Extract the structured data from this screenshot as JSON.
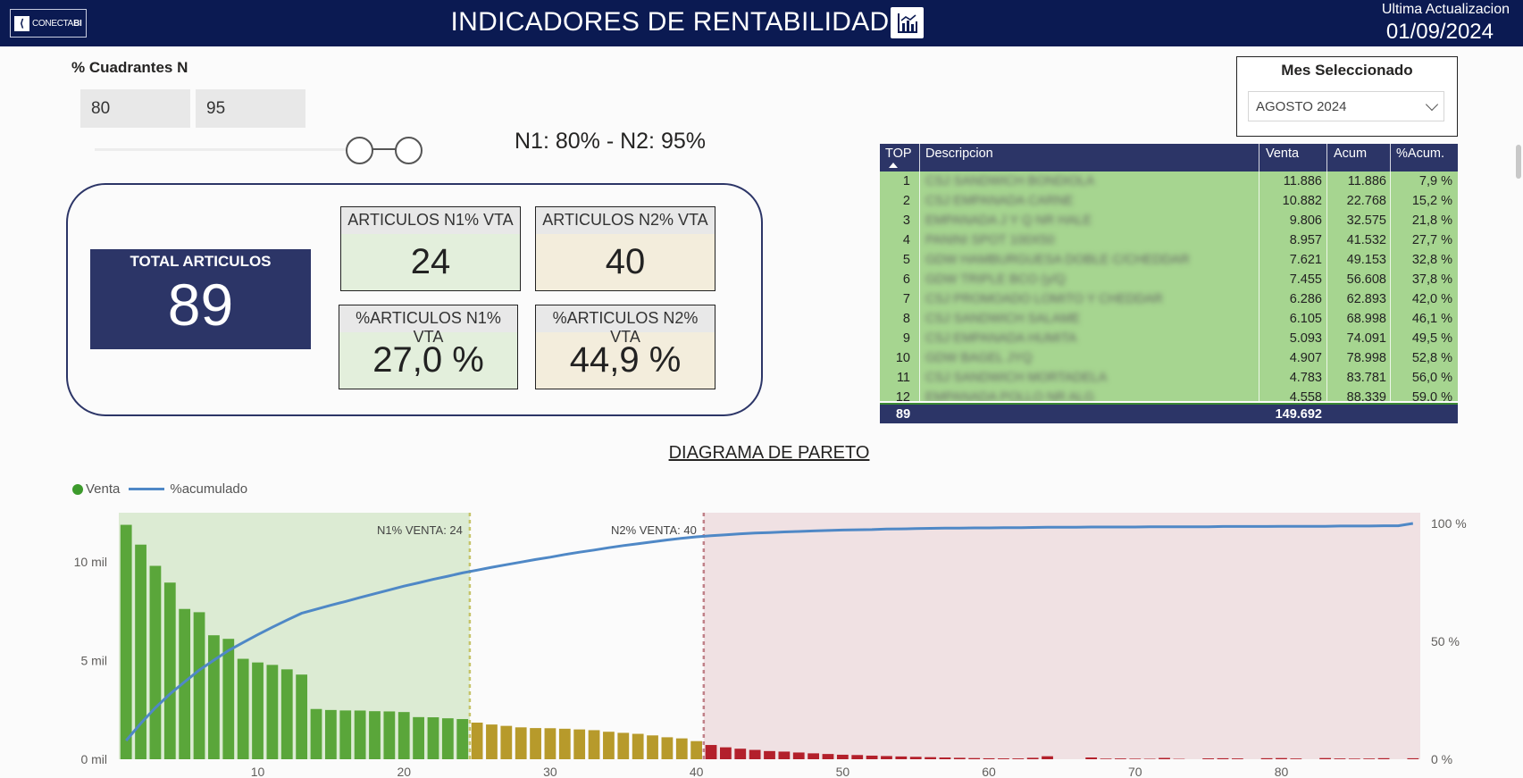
{
  "header": {
    "logo_text": "CONECTA",
    "logo_bold": "BI",
    "title": "INDICADORES DE RENTABILIDAD",
    "update_label": "Ultima Actualizacion",
    "update_date": "01/09/2024",
    "icon": "chart-report-icon"
  },
  "quadrants": {
    "title": "% Cuadrantes N",
    "n1": "80",
    "n2": "95",
    "summary": "N1: 80%   -   N2: 95%"
  },
  "kpis": {
    "total_label": "TOTAL ARTICULOS",
    "total_value": "89",
    "n1_label": "ARTICULOS N1% VTA",
    "n1_value": "24",
    "n2_label": "ARTICULOS N2% VTA",
    "n2_value": "40",
    "pct_n1_label": "%ARTICULOS N1% VTA",
    "pct_n1_value": "27,0 %",
    "pct_n2_label": "%ARTICULOS N2% VTA",
    "pct_n2_value": "44,9 %"
  },
  "month_filter": {
    "title": "Mes Seleccionado",
    "selected": "AGOSTO 2024"
  },
  "table": {
    "headers": [
      "TOP",
      "Descripcion",
      "Venta",
      "Acum",
      "%Acum."
    ],
    "rows": [
      {
        "top": "1",
        "desc": "CSJ SANDWICH BONDIOLA",
        "venta": "11.886",
        "acum": "11.886",
        "pct": "7,9 %"
      },
      {
        "top": "2",
        "desc": "CSJ EMPANADA CARNE",
        "venta": "10.882",
        "acum": "22.768",
        "pct": "15,2 %"
      },
      {
        "top": "3",
        "desc": "EMPANADA J Y Q NR HALE",
        "venta": "9.806",
        "acum": "32.575",
        "pct": "21,8 %"
      },
      {
        "top": "4",
        "desc": "PANINI SPOT 100X50",
        "venta": "8.957",
        "acum": "41.532",
        "pct": "27,7 %"
      },
      {
        "top": "5",
        "desc": "GDW HAMBURGUESA DOBLE C/CHEDDAR",
        "venta": "7.621",
        "acum": "49.153",
        "pct": "32,8 %"
      },
      {
        "top": "6",
        "desc": "GDW TRIPLE BCO (y/Q",
        "venta": "7.455",
        "acum": "56.608",
        "pct": "37,8 %"
      },
      {
        "top": "7",
        "desc": "CSJ PROMOADO LOMITO Y CHEDDAR",
        "venta": "6.286",
        "acum": "62.893",
        "pct": "42,0 %"
      },
      {
        "top": "8",
        "desc": "CSJ SANDWICH SALAME",
        "venta": "6.105",
        "acum": "68.998",
        "pct": "46,1 %"
      },
      {
        "top": "9",
        "desc": "CSJ EMPANADA HUMITA",
        "venta": "5.093",
        "acum": "74.091",
        "pct": "49,5 %"
      },
      {
        "top": "10",
        "desc": "GDW BAGEL JYQ",
        "venta": "4.907",
        "acum": "78.998",
        "pct": "52,8 %"
      },
      {
        "top": "11",
        "desc": "CSJ SANDWICH MORTADELA",
        "venta": "4.783",
        "acum": "83.781",
        "pct": "56,0 %"
      },
      {
        "top": "12",
        "desc": "EMPANADA POLLO NR ALG",
        "venta": "4.558",
        "acum": "88.339",
        "pct": "59,0 %"
      }
    ],
    "footer": {
      "top": "89",
      "venta": "149.692"
    }
  },
  "pareto": {
    "title": "DIAGRAMA DE PARETO",
    "legend_venta": "Venta",
    "legend_acum": "%acumulado",
    "n1_annotation": "N1% VENTA: 24",
    "n2_annotation": "N2% VENTA: 40"
  },
  "colors": {
    "header_bg": "#0b1a52",
    "navy": "#2c3567",
    "green": "#5aa63a",
    "gold": "#b79a2b",
    "red": "#b3202b",
    "line": "#4f88c6",
    "zone_green": "#dcebd3",
    "zone_red": "#f0e1e3"
  },
  "chart_data": {
    "type": "bar",
    "x_ticks": [
      10,
      20,
      30,
      40,
      50,
      60,
      70,
      80
    ],
    "y_left_ticks": [
      "0 mil",
      "5 mil",
      "10 mil"
    ],
    "y_right_ticks": [
      "0 %",
      "50 %",
      "100 %"
    ],
    "y_left_range": [
      0,
      12500
    ],
    "y_right_range": [
      0,
      1.0
    ],
    "n1_cutoff": 24,
    "n2_cutoff": 40,
    "series": [
      {
        "name": "Venta",
        "values": [
          11886,
          10882,
          9806,
          8957,
          7621,
          7455,
          6286,
          6105,
          5093,
          4907,
          4783,
          4558,
          4293,
          2548,
          2497,
          2474,
          2470,
          2437,
          2425,
          2393,
          2136,
          2127,
          2076,
          2037,
          1857,
          1761,
          1692,
          1617,
          1581,
          1573,
          1547,
          1512,
          1475,
          1394,
          1339,
          1289,
          1209,
          1114,
          1058,
          919,
          723,
          605,
          535,
          474,
          415,
          388,
          342,
          300,
          266,
          229,
          214,
          183,
          162,
          142,
          123,
          106,
          89,
          73,
          59,
          48,
          42,
          40,
          74,
          152,
          0,
          0,
          90,
          31,
          38,
          29,
          22,
          68,
          18,
          0,
          43,
          50,
          40,
          0,
          52,
          60,
          37,
          0,
          60,
          38,
          31,
          35,
          54,
          0,
          50
        ]
      },
      {
        "name": "%acumulado",
        "values": [
          0.079,
          0.152,
          0.218,
          0.277,
          0.328,
          0.378,
          0.42,
          0.461,
          0.495,
          0.528,
          0.56,
          0.59,
          0.619,
          0.636,
          0.653,
          0.669,
          0.686,
          0.702,
          0.718,
          0.734,
          0.748,
          0.763,
          0.776,
          0.79,
          0.802,
          0.814,
          0.825,
          0.836,
          0.847,
          0.857,
          0.868,
          0.878,
          0.887,
          0.897,
          0.906,
          0.914,
          0.922,
          0.93,
          0.937,
          0.943,
          0.948,
          0.952,
          0.956,
          0.959,
          0.961,
          0.964,
          0.966,
          0.968,
          0.97,
          0.972,
          0.973,
          0.974,
          0.976,
          0.977,
          0.978,
          0.979,
          0.98,
          0.98,
          0.981,
          0.981,
          0.982,
          0.982,
          0.983,
          0.984,
          0.984,
          0.984,
          0.985,
          0.985,
          0.985,
          0.985,
          0.986,
          0.986,
          0.986,
          0.986,
          0.986,
          0.987,
          0.987,
          0.987,
          0.987,
          0.988,
          0.988,
          0.988,
          0.988,
          0.989,
          0.989,
          0.989,
          0.99,
          0.99,
          1.0
        ]
      }
    ]
  }
}
